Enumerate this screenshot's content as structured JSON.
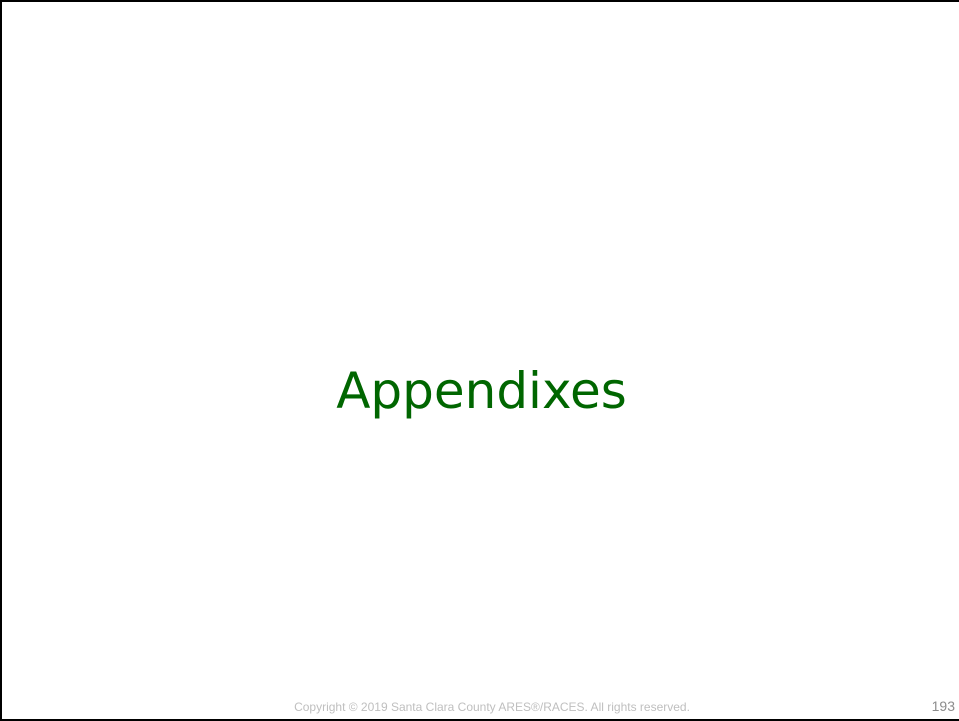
{
  "slide": {
    "title": "Appendixes",
    "title_color": "#006600",
    "footer": {
      "copyright": "Copyright © 2019 Santa Clara County ARES®/RACES.  All rights reserved.",
      "page_number": "193"
    }
  }
}
